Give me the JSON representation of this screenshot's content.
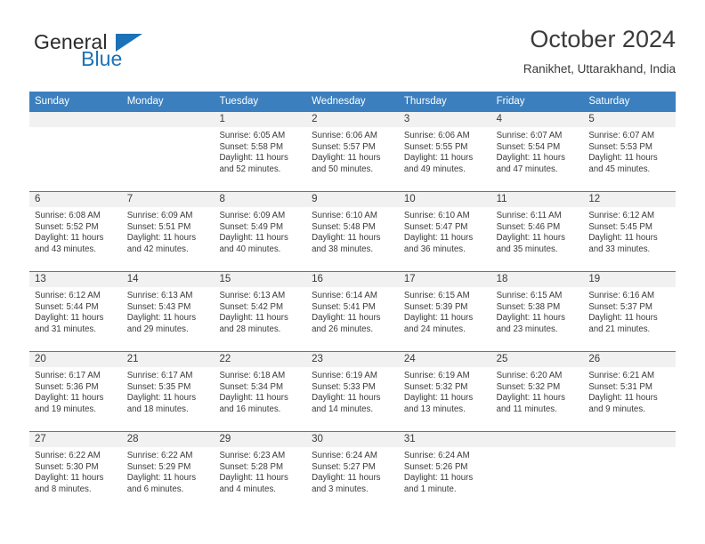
{
  "brand": {
    "name_part1": "General",
    "name_part2": "Blue",
    "triangle_icon": "triangle-icon",
    "accent_color": "#1b72b8"
  },
  "header": {
    "title": "October 2024",
    "subtitle": "Ranikhet, Uttarakhand, India"
  },
  "calendar": {
    "header_color": "#3b7fbe",
    "day_strip_color": "#f1f1f1",
    "weekdays": [
      "Sunday",
      "Monday",
      "Tuesday",
      "Wednesday",
      "Thursday",
      "Friday",
      "Saturday"
    ],
    "weeks": [
      [
        {
          "date": "",
          "sunrise": "",
          "sunset": "",
          "daylight": ""
        },
        {
          "date": "",
          "sunrise": "",
          "sunset": "",
          "daylight": ""
        },
        {
          "date": "1",
          "sunrise": "Sunrise: 6:05 AM",
          "sunset": "Sunset: 5:58 PM",
          "daylight": "Daylight: 11 hours and 52 minutes."
        },
        {
          "date": "2",
          "sunrise": "Sunrise: 6:06 AM",
          "sunset": "Sunset: 5:57 PM",
          "daylight": "Daylight: 11 hours and 50 minutes."
        },
        {
          "date": "3",
          "sunrise": "Sunrise: 6:06 AM",
          "sunset": "Sunset: 5:55 PM",
          "daylight": "Daylight: 11 hours and 49 minutes."
        },
        {
          "date": "4",
          "sunrise": "Sunrise: 6:07 AM",
          "sunset": "Sunset: 5:54 PM",
          "daylight": "Daylight: 11 hours and 47 minutes."
        },
        {
          "date": "5",
          "sunrise": "Sunrise: 6:07 AM",
          "sunset": "Sunset: 5:53 PM",
          "daylight": "Daylight: 11 hours and 45 minutes."
        }
      ],
      [
        {
          "date": "6",
          "sunrise": "Sunrise: 6:08 AM",
          "sunset": "Sunset: 5:52 PM",
          "daylight": "Daylight: 11 hours and 43 minutes."
        },
        {
          "date": "7",
          "sunrise": "Sunrise: 6:09 AM",
          "sunset": "Sunset: 5:51 PM",
          "daylight": "Daylight: 11 hours and 42 minutes."
        },
        {
          "date": "8",
          "sunrise": "Sunrise: 6:09 AM",
          "sunset": "Sunset: 5:49 PM",
          "daylight": "Daylight: 11 hours and 40 minutes."
        },
        {
          "date": "9",
          "sunrise": "Sunrise: 6:10 AM",
          "sunset": "Sunset: 5:48 PM",
          "daylight": "Daylight: 11 hours and 38 minutes."
        },
        {
          "date": "10",
          "sunrise": "Sunrise: 6:10 AM",
          "sunset": "Sunset: 5:47 PM",
          "daylight": "Daylight: 11 hours and 36 minutes."
        },
        {
          "date": "11",
          "sunrise": "Sunrise: 6:11 AM",
          "sunset": "Sunset: 5:46 PM",
          "daylight": "Daylight: 11 hours and 35 minutes."
        },
        {
          "date": "12",
          "sunrise": "Sunrise: 6:12 AM",
          "sunset": "Sunset: 5:45 PM",
          "daylight": "Daylight: 11 hours and 33 minutes."
        }
      ],
      [
        {
          "date": "13",
          "sunrise": "Sunrise: 6:12 AM",
          "sunset": "Sunset: 5:44 PM",
          "daylight": "Daylight: 11 hours and 31 minutes."
        },
        {
          "date": "14",
          "sunrise": "Sunrise: 6:13 AM",
          "sunset": "Sunset: 5:43 PM",
          "daylight": "Daylight: 11 hours and 29 minutes."
        },
        {
          "date": "15",
          "sunrise": "Sunrise: 6:13 AM",
          "sunset": "Sunset: 5:42 PM",
          "daylight": "Daylight: 11 hours and 28 minutes."
        },
        {
          "date": "16",
          "sunrise": "Sunrise: 6:14 AM",
          "sunset": "Sunset: 5:41 PM",
          "daylight": "Daylight: 11 hours and 26 minutes."
        },
        {
          "date": "17",
          "sunrise": "Sunrise: 6:15 AM",
          "sunset": "Sunset: 5:39 PM",
          "daylight": "Daylight: 11 hours and 24 minutes."
        },
        {
          "date": "18",
          "sunrise": "Sunrise: 6:15 AM",
          "sunset": "Sunset: 5:38 PM",
          "daylight": "Daylight: 11 hours and 23 minutes."
        },
        {
          "date": "19",
          "sunrise": "Sunrise: 6:16 AM",
          "sunset": "Sunset: 5:37 PM",
          "daylight": "Daylight: 11 hours and 21 minutes."
        }
      ],
      [
        {
          "date": "20",
          "sunrise": "Sunrise: 6:17 AM",
          "sunset": "Sunset: 5:36 PM",
          "daylight": "Daylight: 11 hours and 19 minutes."
        },
        {
          "date": "21",
          "sunrise": "Sunrise: 6:17 AM",
          "sunset": "Sunset: 5:35 PM",
          "daylight": "Daylight: 11 hours and 18 minutes."
        },
        {
          "date": "22",
          "sunrise": "Sunrise: 6:18 AM",
          "sunset": "Sunset: 5:34 PM",
          "daylight": "Daylight: 11 hours and 16 minutes."
        },
        {
          "date": "23",
          "sunrise": "Sunrise: 6:19 AM",
          "sunset": "Sunset: 5:33 PM",
          "daylight": "Daylight: 11 hours and 14 minutes."
        },
        {
          "date": "24",
          "sunrise": "Sunrise: 6:19 AM",
          "sunset": "Sunset: 5:32 PM",
          "daylight": "Daylight: 11 hours and 13 minutes."
        },
        {
          "date": "25",
          "sunrise": "Sunrise: 6:20 AM",
          "sunset": "Sunset: 5:32 PM",
          "daylight": "Daylight: 11 hours and 11 minutes."
        },
        {
          "date": "26",
          "sunrise": "Sunrise: 6:21 AM",
          "sunset": "Sunset: 5:31 PM",
          "daylight": "Daylight: 11 hours and 9 minutes."
        }
      ],
      [
        {
          "date": "27",
          "sunrise": "Sunrise: 6:22 AM",
          "sunset": "Sunset: 5:30 PM",
          "daylight": "Daylight: 11 hours and 8 minutes."
        },
        {
          "date": "28",
          "sunrise": "Sunrise: 6:22 AM",
          "sunset": "Sunset: 5:29 PM",
          "daylight": "Daylight: 11 hours and 6 minutes."
        },
        {
          "date": "29",
          "sunrise": "Sunrise: 6:23 AM",
          "sunset": "Sunset: 5:28 PM",
          "daylight": "Daylight: 11 hours and 4 minutes."
        },
        {
          "date": "30",
          "sunrise": "Sunrise: 6:24 AM",
          "sunset": "Sunset: 5:27 PM",
          "daylight": "Daylight: 11 hours and 3 minutes."
        },
        {
          "date": "31",
          "sunrise": "Sunrise: 6:24 AM",
          "sunset": "Sunset: 5:26 PM",
          "daylight": "Daylight: 11 hours and 1 minute."
        },
        {
          "date": "",
          "sunrise": "",
          "sunset": "",
          "daylight": ""
        },
        {
          "date": "",
          "sunrise": "",
          "sunset": "",
          "daylight": ""
        }
      ]
    ]
  }
}
